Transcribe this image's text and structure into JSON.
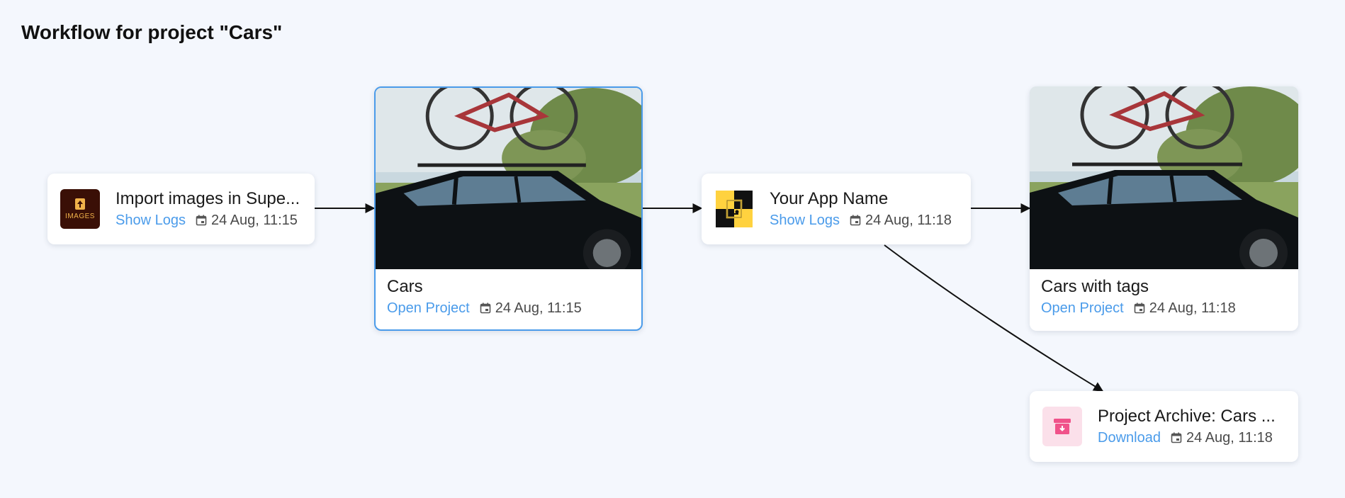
{
  "page": {
    "title": "Workflow for project \"Cars\""
  },
  "nodes": {
    "import": {
      "title": "Import images in Supe...",
      "action": "Show Logs",
      "timestamp": "24 Aug, 11:15",
      "thumb_text": "IMAGES",
      "icon": "upload-images-app-icon"
    },
    "cars": {
      "title": "Cars",
      "action": "Open Project",
      "timestamp": "24 Aug, 11:15"
    },
    "app": {
      "title": "Your App Name",
      "action": "Show Logs",
      "timestamp": "24 Aug, 11:18",
      "icon": "robot-app-icon"
    },
    "tags": {
      "title": "Cars with tags",
      "action": "Open Project",
      "timestamp": "24 Aug, 11:18"
    },
    "archive": {
      "title": "Project Archive: Cars ...",
      "action": "Download",
      "timestamp": "24 Aug, 11:18",
      "icon": "archive-download-icon"
    }
  },
  "colors": {
    "accent": "#4a9bea",
    "background": "#f4f7fd",
    "archive_icon_bg": "#fbe0ea",
    "archive_icon": "#f0528a",
    "app_icon_yellow": "#ffd23f",
    "import_icon_bg": "#3a0f06",
    "import_icon_text": "#f0b24a"
  }
}
